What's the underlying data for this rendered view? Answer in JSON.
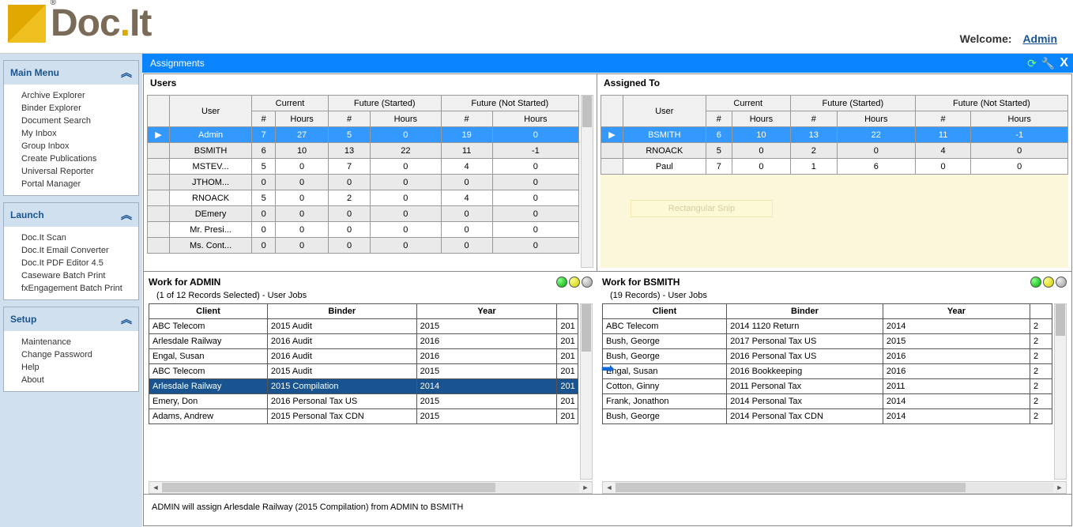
{
  "brand": {
    "name1": "Doc",
    "name2": "It"
  },
  "welcome": {
    "label": "Welcome:",
    "user": "Admin"
  },
  "sidebar": {
    "menus": [
      {
        "title": "Main Menu",
        "items": [
          "Archive Explorer",
          "Binder Explorer",
          "Document Search",
          "My Inbox",
          "Group Inbox",
          "Create Publications",
          "Universal Reporter",
          "Portal Manager"
        ]
      },
      {
        "title": "Launch",
        "items": [
          "Doc.It Scan",
          "Doc.It Email Converter",
          "Doc.It PDF Editor 4.5",
          "Caseware Batch Print",
          "fxEngagement Batch Print"
        ]
      },
      {
        "title": "Setup",
        "items": [
          "Maintenance",
          "Change Password",
          "Help",
          "About"
        ]
      }
    ]
  },
  "tab": {
    "title": "Assignments"
  },
  "users": {
    "title": "Users",
    "group_headers": [
      "Current",
      "Future (Started)",
      "Future (Not Started)"
    ],
    "col_headers": [
      "User",
      "#",
      "Hours",
      "#",
      "Hours",
      "#",
      "Hours"
    ],
    "rows": [
      {
        "cells": [
          "Admin",
          "7",
          "27",
          "5",
          "0",
          "19",
          "0"
        ],
        "selected": true
      },
      {
        "cells": [
          "BSMITH",
          "6",
          "10",
          "13",
          "22",
          "11",
          "-1"
        ],
        "alt": true
      },
      {
        "cells": [
          "MSTEV...",
          "5",
          "0",
          "7",
          "0",
          "4",
          "0"
        ]
      },
      {
        "cells": [
          "JTHOM...",
          "0",
          "0",
          "0",
          "0",
          "0",
          "0"
        ],
        "alt": true
      },
      {
        "cells": [
          "RNOACK",
          "5",
          "0",
          "2",
          "0",
          "4",
          "0"
        ]
      },
      {
        "cells": [
          "DEmery",
          "0",
          "0",
          "0",
          "0",
          "0",
          "0"
        ],
        "alt": true
      },
      {
        "cells": [
          "Mr. Presi...",
          "0",
          "0",
          "0",
          "0",
          "0",
          "0"
        ]
      },
      {
        "cells": [
          "Ms. Cont...",
          "0",
          "0",
          "0",
          "0",
          "0",
          "0"
        ],
        "alt": true
      }
    ]
  },
  "assigned": {
    "title": "Assigned To",
    "group_headers": [
      "Current",
      "Future (Started)",
      "Future (Not Started)"
    ],
    "col_headers": [
      "User",
      "#",
      "Hours",
      "#",
      "Hours",
      "#",
      "Hours"
    ],
    "rows": [
      {
        "cells": [
          "BSMITH",
          "6",
          "10",
          "13",
          "22",
          "11",
          "-1"
        ],
        "selected": true
      },
      {
        "cells": [
          "RNOACK",
          "5",
          "0",
          "2",
          "0",
          "4",
          "0"
        ],
        "alt": true
      },
      {
        "cells": [
          "Paul",
          "7",
          "0",
          "1",
          "6",
          "0",
          "0"
        ]
      }
    ],
    "snip": "Rectangular Snip"
  },
  "work_admin": {
    "title": "Work for ADMIN",
    "records": "(1 of 12 Records Selected) - User Jobs",
    "headers": [
      "Client",
      "Binder",
      "Year",
      ""
    ],
    "rows": [
      {
        "c": [
          "ABC Telecom",
          "2015 Audit",
          "2015",
          "201"
        ]
      },
      {
        "c": [
          "Arlesdale Railway",
          "2016 Audit",
          "2016",
          "201"
        ]
      },
      {
        "c": [
          "Engal, Susan",
          "2016 Audit",
          "2016",
          "201"
        ]
      },
      {
        "c": [
          "ABC Telecom",
          "2015 Audit",
          "2015",
          "201"
        ]
      },
      {
        "c": [
          "Arlesdale Railway",
          "2015 Compilation",
          "2014",
          "201"
        ],
        "sel": true
      },
      {
        "c": [
          "Emery, Don",
          "2016 Personal Tax  US",
          "2015",
          "201"
        ]
      },
      {
        "c": [
          "Adams, Andrew",
          "2015 Personal Tax CDN",
          "2015",
          "201"
        ]
      }
    ]
  },
  "work_bsmith": {
    "title": "Work for BSMITH",
    "records": "(19 Records) - User Jobs",
    "headers": [
      "Client",
      "Binder",
      "Year",
      ""
    ],
    "rows": [
      {
        "c": [
          "ABC Telecom",
          "2014 1120 Return",
          "2014",
          "2"
        ]
      },
      {
        "c": [
          "Bush, George",
          "2017 Personal Tax  US",
          "2015",
          "2"
        ]
      },
      {
        "c": [
          "Bush, George",
          "2016 Personal Tax  US",
          "2016",
          "2"
        ]
      },
      {
        "c": [
          "Engal, Susan",
          "2016 Bookkeeping",
          "2016",
          "2"
        ]
      },
      {
        "c": [
          "Cotton, Ginny",
          "2011 Personal Tax",
          "2011",
          "2"
        ]
      },
      {
        "c": [
          "Frank, Jonathon",
          "2014 Personal Tax",
          "2014",
          "2"
        ]
      },
      {
        "c": [
          "Bush, George",
          "2014 Personal Tax CDN",
          "2014",
          "2"
        ]
      }
    ]
  },
  "status": "ADMIN will assign  Arlesdale Railway (2015 Compilation) from ADMIN to BSMITH"
}
